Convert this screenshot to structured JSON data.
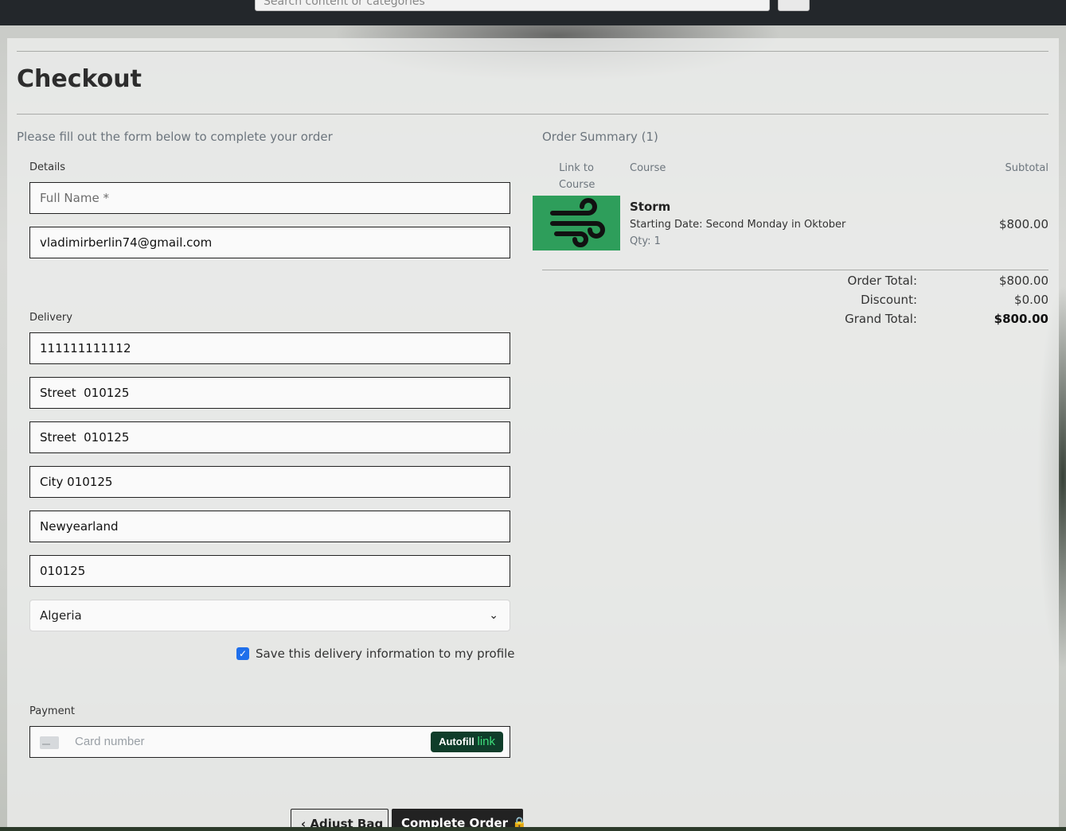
{
  "header": {
    "search_placeholder": "Search content or categories"
  },
  "page": {
    "title": "Checkout",
    "intro": "Please fill out the form below to complete your order"
  },
  "form": {
    "details_label": "Details",
    "full_name_placeholder": "Full Name *",
    "email_value": "vladimirberlin74@gmail.com",
    "delivery_label": "Delivery",
    "phone_value": "111111111112",
    "street1_value": "Street  010125",
    "street2_value": "Street  010125",
    "city_value": "City 010125",
    "county_value": "Newyearland",
    "postcode_value": "010125",
    "country_selected": "Algeria",
    "save_info_label": "Save this delivery information to my profile",
    "save_info_checked": true,
    "payment_label": "Payment",
    "card_placeholder": "Card number",
    "autofill_label": "Autofill",
    "autofill_link": "link"
  },
  "buttons": {
    "adjust_bag": "Adjust Bag",
    "complete_order": "Complete Order"
  },
  "summary": {
    "title": "Order Summary (1)",
    "columns": {
      "link_line1": "Link to",
      "link_line2": "Course",
      "course": "Course",
      "subtotal": "Subtotal"
    },
    "item": {
      "name": "Storm",
      "date": "Starting Date: Second Monday in Oktober",
      "qty": "Qty: 1",
      "price": "$800.00",
      "icon": "wind-icon"
    },
    "order_total_label": "Order Total:",
    "order_total": "$800.00",
    "discount_label": "Discount:",
    "discount": "$0.00",
    "grand_total_label": "Grand Total:",
    "grand_total": "$800.00"
  },
  "colors": {
    "thumb_bg": "#2e9e5b",
    "checkbox": "#1f6feb",
    "autofill_bg": "#0f3d2a",
    "autofill_link": "#3ddc7a"
  }
}
